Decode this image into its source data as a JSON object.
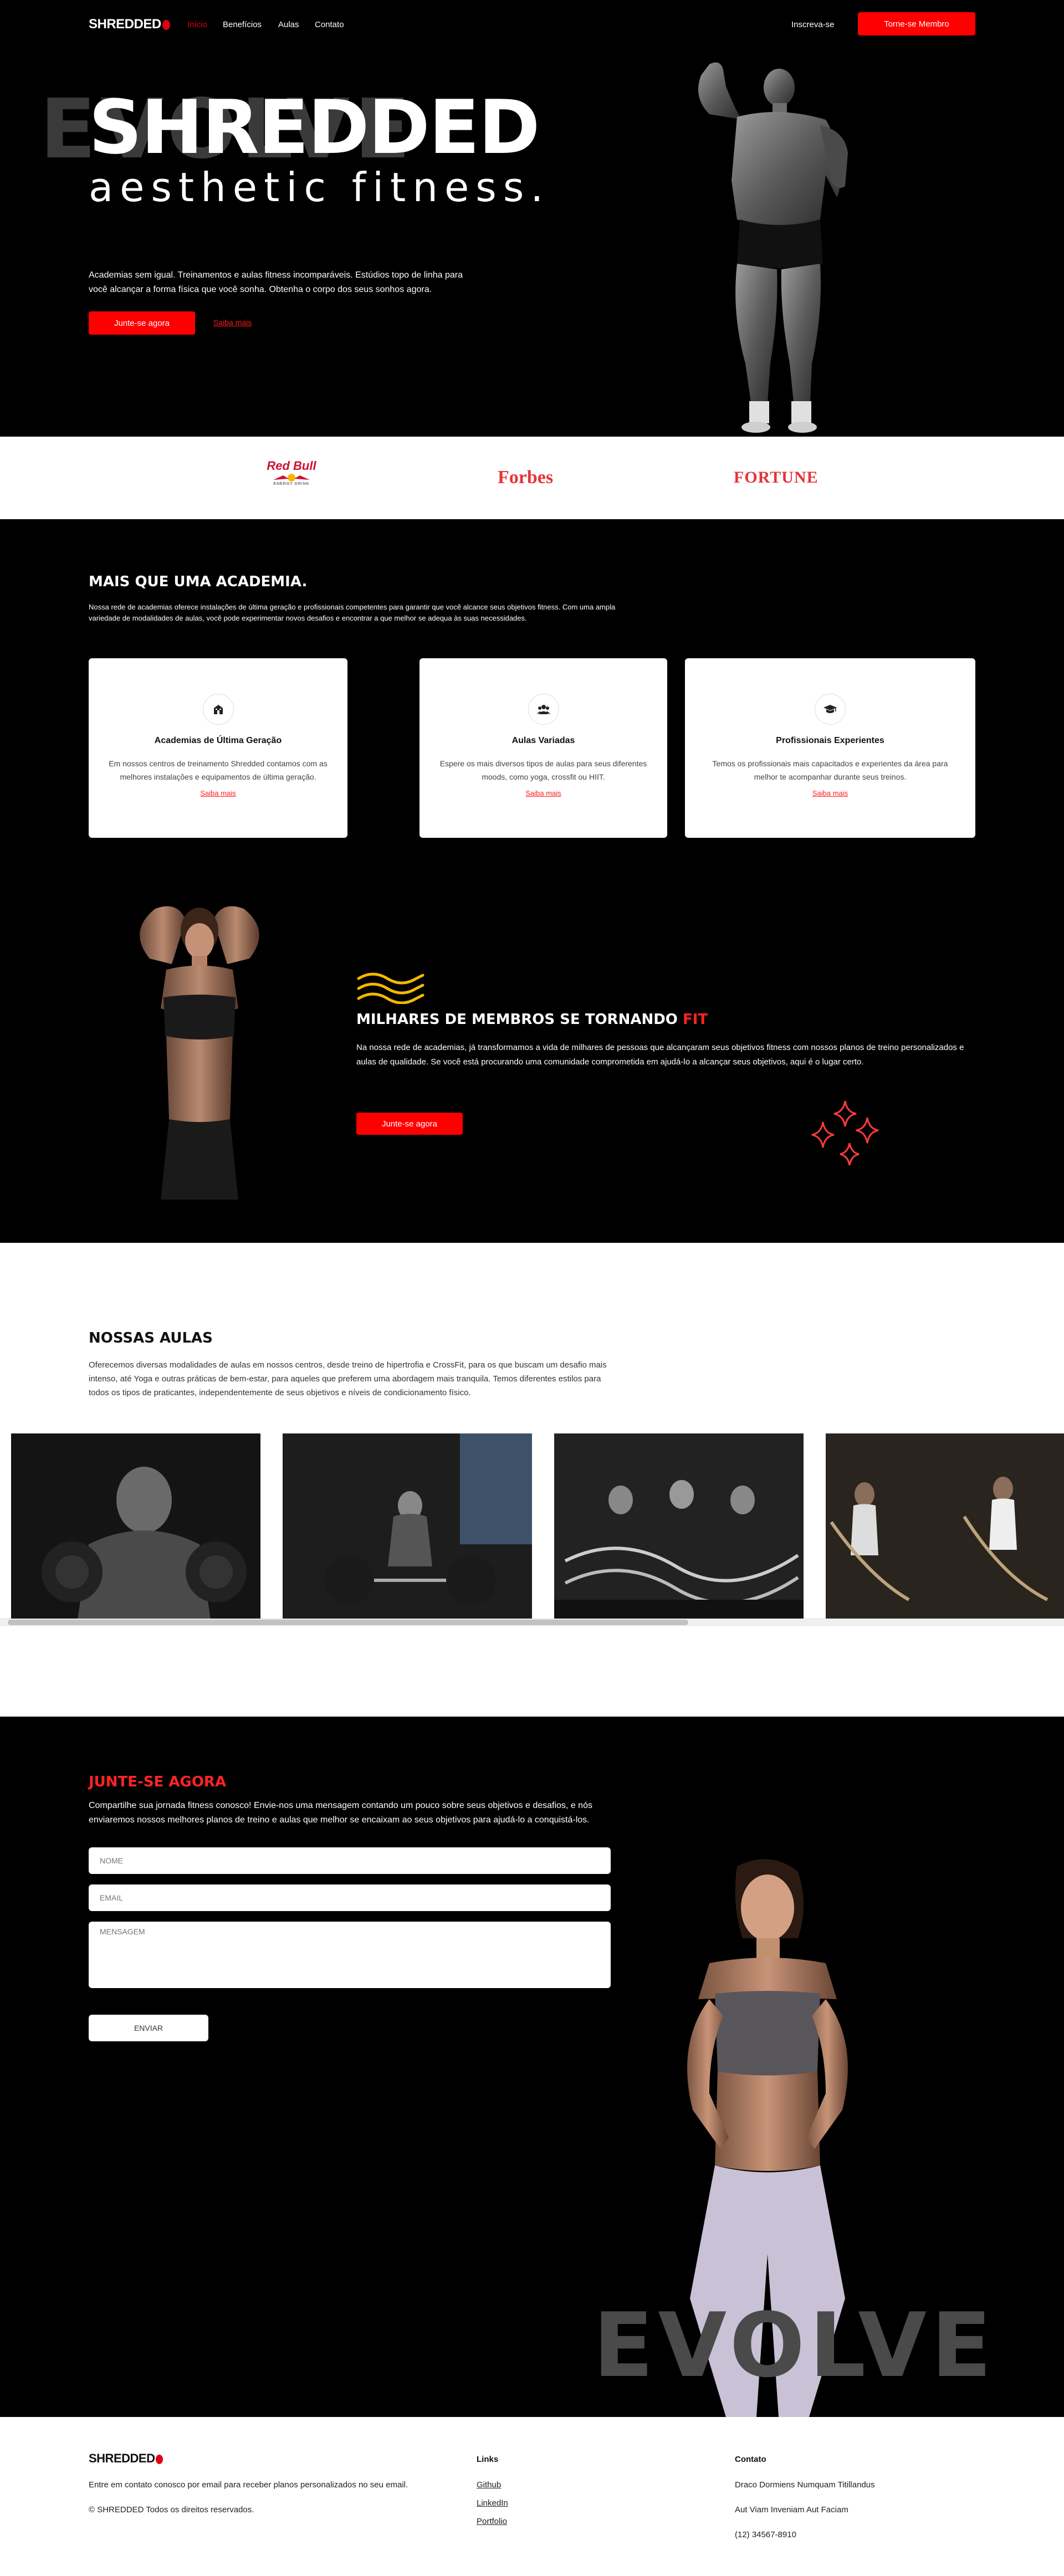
{
  "nav": {
    "logo": "SHREDDED",
    "links": [
      "Início",
      "Benefícios",
      "Aulas",
      "Contato"
    ],
    "signup": "Inscreva-se",
    "member_button": "Torne-se Membro"
  },
  "hero": {
    "bg_word": "EVOLVE",
    "title": "SHREDDED",
    "subtitle": "aesthetic fitness.",
    "description": "Academias sem igual. Treinamentos e aulas fitness incomparáveis. Estúdios topo de linha para você alcançar a forma física que você sonha. Obtenha o corpo dos seus sonhos agora.",
    "cta": "Junte-se agora",
    "more": "Saiba mais"
  },
  "brands": {
    "redbull": "Red Bull",
    "redbull_sub": "ENERGY DRINK",
    "forbes": "Forbes",
    "fortune": "FORTUNE"
  },
  "features": {
    "title": "MAIS QUE UMA ACADEMIA.",
    "description": "Nossa rede de academias oferece instalações de última geração e profissionais competentes para garantir que você alcance seus objetivos fitness. Com uma ampla variedade de modalidades de aulas, você pode experimentar novos desafios e encontrar a que melhor se adequa às suas necessidades.",
    "cards": [
      {
        "title": "Academias de Última Geração",
        "desc": "Em nossos centros de treinamento Shredded contamos com as melhores instalações e equipamentos de última geração.",
        "link": "Saiba mais",
        "icon": "building-icon"
      },
      {
        "title": "Aulas Variadas",
        "desc": "Espere os mais diversos tipos de aulas para seus diferentes moods, como yoga, crossfit ou HIIT.",
        "link": "Saiba mais",
        "icon": "group-icon"
      },
      {
        "title": "Profissionais Experientes",
        "desc": "Temos os profissionais mais capacitados e experientes da área para melhor te acompanhar durante seus treinos.",
        "link": "Saiba mais",
        "icon": "graduation-cap-icon"
      }
    ]
  },
  "members": {
    "title": "MILHARES DE MEMBROS SE TORNANDO ",
    "title_accent": "FIT",
    "description": "Na nossa rede de academias, já transformamos a vida de milhares de pessoas que alcançaram seus objetivos fitness com nossos planos de treino personalizados e aulas de qualidade. Se você está procurando uma comunidade comprometida em ajudá-lo a alcançar seus objetivos, aqui é o lugar certo.",
    "cta": "Junte-se agora"
  },
  "classes": {
    "title": "NOSSAS AULAS",
    "description": "Oferecemos diversas modalidades de aulas em nossos centros, desde treino de hipertrofia e CrossFit, para os que buscam um desafio mais intenso, até Yoga e outras práticas de bem-estar, para aqueles que preferem uma abordagem mais tranquila. Temos diferentes estilos para todos os tipos de praticantes, independentemente de seus objetivos e níveis de condicionamento físico."
  },
  "join": {
    "title": "JUNTE-SE AGORA",
    "description": "Compartilhe sua jornada fitness conosco! Envie-nos uma mensagem contando um pouco sobre seus objetivos e desafios, e nós enviaremos nossos melhores planos de treino e aulas que melhor se encaixam ao seus objetivos para ajudá-lo a conquistá-los.",
    "name_placeholder": "NOME",
    "email_placeholder": "EMAIL",
    "message_placeholder": "MENSAGEM",
    "submit": "ENVIAR",
    "bg_word": "EVOLVE"
  },
  "footer": {
    "logo": "SHREDDED",
    "tagline": "Entre em contato conosco por email para receber planos personalizados no seu email.",
    "copyright": "© SHREDDED Todos os direitos reservados.",
    "links_title": "Links",
    "links": [
      "Github",
      "LinkedIn",
      "Portfolio"
    ],
    "contact_title": "Contato",
    "contact": [
      "Draco Dormiens Numquam Titillandus",
      "Aut Viam Inveniam Aut Faciam",
      "(12) 34567-8910"
    ]
  },
  "colors": {
    "accent": "#ff0000",
    "background": "#000000",
    "surface": "#ffffff"
  }
}
